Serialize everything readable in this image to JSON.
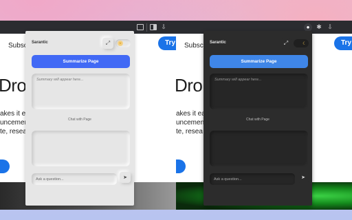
{
  "site": {
    "nav_text": "Subsc",
    "cta_label": "Try",
    "hero_heading": "Drop",
    "paragraph_lines": [
      "akes it ea",
      "uncemen",
      "te, resea"
    ]
  },
  "extension": {
    "title": "Sarantic",
    "summarize_label": "Summarize Page",
    "summary_placeholder": "Summary will appear here...",
    "chat_label": "Chat with Page",
    "ask_placeholder": "Ask a question...",
    "theme_modes": [
      "light",
      "dark"
    ]
  },
  "icons": {
    "expand": "expand-icon",
    "sun": "sun-icon",
    "moon": "moon-icon",
    "send": "send-icon"
  },
  "colors": {
    "summarize_light": "#4169f5",
    "summarize_dark": "#3f86e8",
    "site_accent": "#1a73e8"
  }
}
